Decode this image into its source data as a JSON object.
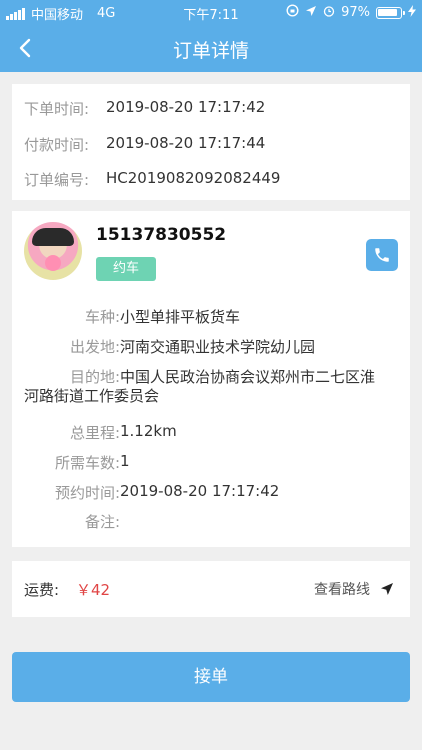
{
  "status_bar": {
    "carrier": "中国移动",
    "network": "4G",
    "time": "下午7:11",
    "battery": "97%"
  },
  "nav": {
    "title": "订单详情",
    "back_icon": "chevron-left-icon"
  },
  "times": {
    "order_time_label": "下单时间:",
    "order_time": "2019-08-20 17:17:42",
    "pay_time_label": "付款时间:",
    "pay_time": "2019-08-20 17:17:44",
    "order_no_label": "订单编号:",
    "order_no": "HC2019082092082449"
  },
  "order": {
    "phone": "15137830552",
    "tag": "约车",
    "vehicle_label": "车种:",
    "vehicle": "小型单排平板货车",
    "origin_label": "出发地:",
    "origin": "河南交通职业技术学院幼儿园",
    "destination_label": "目的地:",
    "destination_line1": "中国人民政治协商会议郑州市二七区淮",
    "destination_line2": "河路街道工作委员会",
    "distance_label": "总里程:",
    "distance": "1.12km",
    "cars_label": "所需车数:",
    "cars": "1",
    "appointment_label": "预约时间:",
    "appointment": "2019-08-20 17:17:42",
    "remark_label": "备注:",
    "remark": ""
  },
  "fee": {
    "label": "运费:",
    "value": "￥42",
    "route_link": "查看路线"
  },
  "actions": {
    "accept": "接单"
  },
  "colors": {
    "primary": "#5aaee8",
    "tag": "#6ed3b3",
    "price": "#e04545"
  }
}
